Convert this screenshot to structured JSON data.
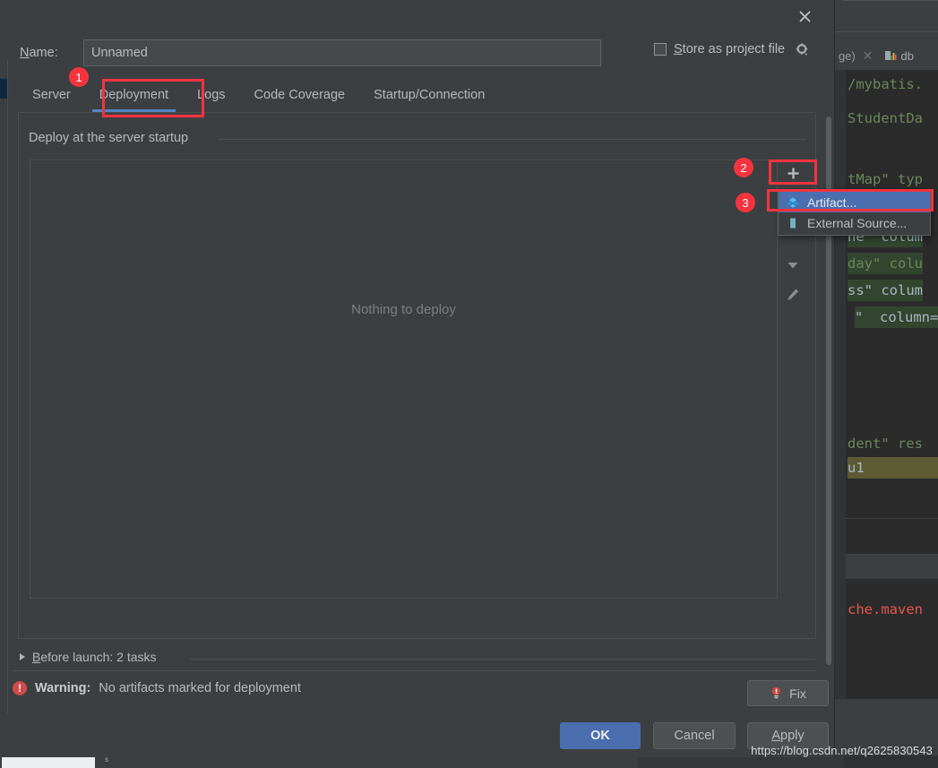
{
  "dialog": {
    "close_icon": "close-icon",
    "name_label": "Name:",
    "name_label_mnemonic": "N",
    "name_value": "Unnamed",
    "name_placeholder": "Unnamed",
    "store_as_project_file": "Store as project file",
    "store_mnemonic": "S",
    "gear_icon": "gear-icon",
    "tabs": [
      {
        "label": "Server",
        "active": false
      },
      {
        "label": "Deployment",
        "active": true
      },
      {
        "label": "Logs",
        "active": false
      },
      {
        "label": "Code Coverage",
        "active": false
      },
      {
        "label": "Startup/Connection",
        "active": false
      }
    ],
    "section_title": "Deploy at the server startup",
    "empty_state": "Nothing to deploy",
    "toolbar": {
      "add_label": "+",
      "add_icon": "plus-icon",
      "down_icon": "chevron-down-icon",
      "edit_icon": "pencil-icon"
    },
    "dropdown": {
      "items": [
        {
          "label": "Artifact...",
          "icon": "artifact-diamond-icon",
          "selected": true
        },
        {
          "label": "External Source...",
          "icon": "external-source-icon",
          "selected": false
        }
      ]
    },
    "before_launch": "Before launch: 2 tasks",
    "before_launch_mnemonic": "B",
    "warning_prefix": "Warning:",
    "warning_text": "No artifacts marked for deployment",
    "fix_label": "Fix",
    "fix_icon": "lightbulb-warning-icon",
    "buttons": {
      "ok": "OK",
      "cancel": "Cancel",
      "apply": "Apply",
      "apply_mnemonic": "A"
    }
  },
  "annotations": {
    "badges": [
      {
        "number": "1"
      },
      {
        "number": "2"
      },
      {
        "number": "3"
      }
    ],
    "color": "#f5333f"
  },
  "background_ide": {
    "tab_text": "ge)",
    "tab_close_icon": "close-icon",
    "db_tab_text": "db",
    "db_icon": "database-chart-icon",
    "code_lines": [
      "/mybatis.",
      "StudentDa",
      "tMap\" typ",
      "ne  colum",
      "day\" colu",
      "ss\" colum",
      "\"  column=",
      "dent\" res",
      "u1",
      "che.maven"
    ]
  },
  "watermark": "https://blog.csdn.net/q2625830543"
}
